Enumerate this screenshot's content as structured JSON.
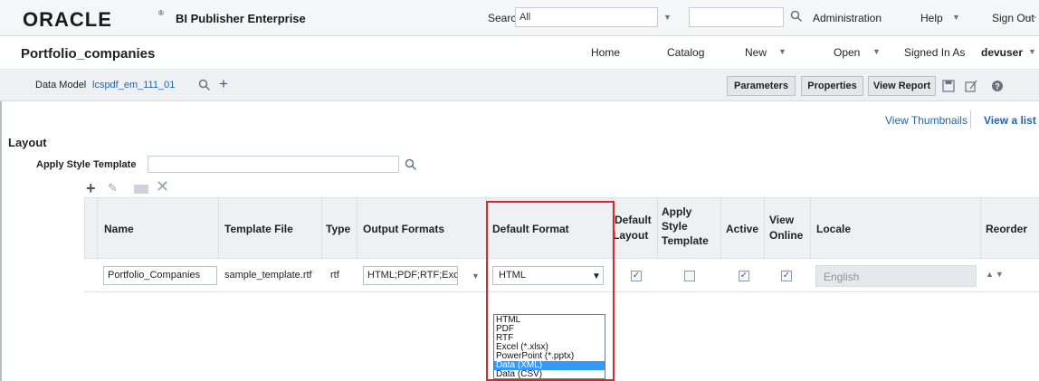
{
  "header": {
    "brand": "ORACLE",
    "brand_mark": "®",
    "product": "BI Publisher Enterprise",
    "search_label": "Search",
    "search_scope": "All",
    "search_text": "",
    "administration": "Administration",
    "help": "Help",
    "sign_out": "Sign Out"
  },
  "reportbar": {
    "title": "Portfolio_companies",
    "home": "Home",
    "catalog": "Catalog",
    "new": "New",
    "open": "Open",
    "signed_in_as": "Signed In As",
    "user": "devuser"
  },
  "toolbar": {
    "data_model_label": "Data Model",
    "data_model_value": "lcspdf_em_111_01",
    "parameters": "Parameters",
    "properties": "Properties",
    "view_report": "View Report"
  },
  "layout": {
    "view_thumbnails": "View Thumbnails",
    "view_list": "View a list",
    "heading": "Layout",
    "apply_style_template_label": "Apply Style Template",
    "apply_style_template_value": ""
  },
  "table": {
    "columns": {
      "name": "Name",
      "template_file": "Template File",
      "type": "Type",
      "output_formats": "Output Formats",
      "default_format": "Default Format",
      "default_layout_1": "Default",
      "default_layout_2": "Layout",
      "apply_style_1": "Apply",
      "apply_style_2": "Style",
      "apply_style_3": "Template",
      "active": "Active",
      "view_online_1": "View",
      "view_online_2": "Online",
      "locale": "Locale",
      "reorder": "Reorder"
    },
    "row": {
      "name": "Portfolio_Companies",
      "template_file": "sample_template.rtf",
      "type": "rtf",
      "output_formats": "HTML;PDF;RTF;Excel",
      "default_format": "HTML",
      "default_layout": true,
      "apply_style": false,
      "active": true,
      "view_online": true,
      "locale": "English"
    }
  },
  "dropdown": {
    "options": [
      "HTML",
      "PDF",
      "RTF",
      "Excel (*.xlsx)",
      "PowerPoint (*.pptx)",
      "Data (XML)",
      "Data (CSV)"
    ],
    "highlighted": "Data (XML)"
  },
  "colors": {
    "highlight_border": "#e0262b",
    "link": "#2166ac",
    "selection": "#3399ff"
  }
}
